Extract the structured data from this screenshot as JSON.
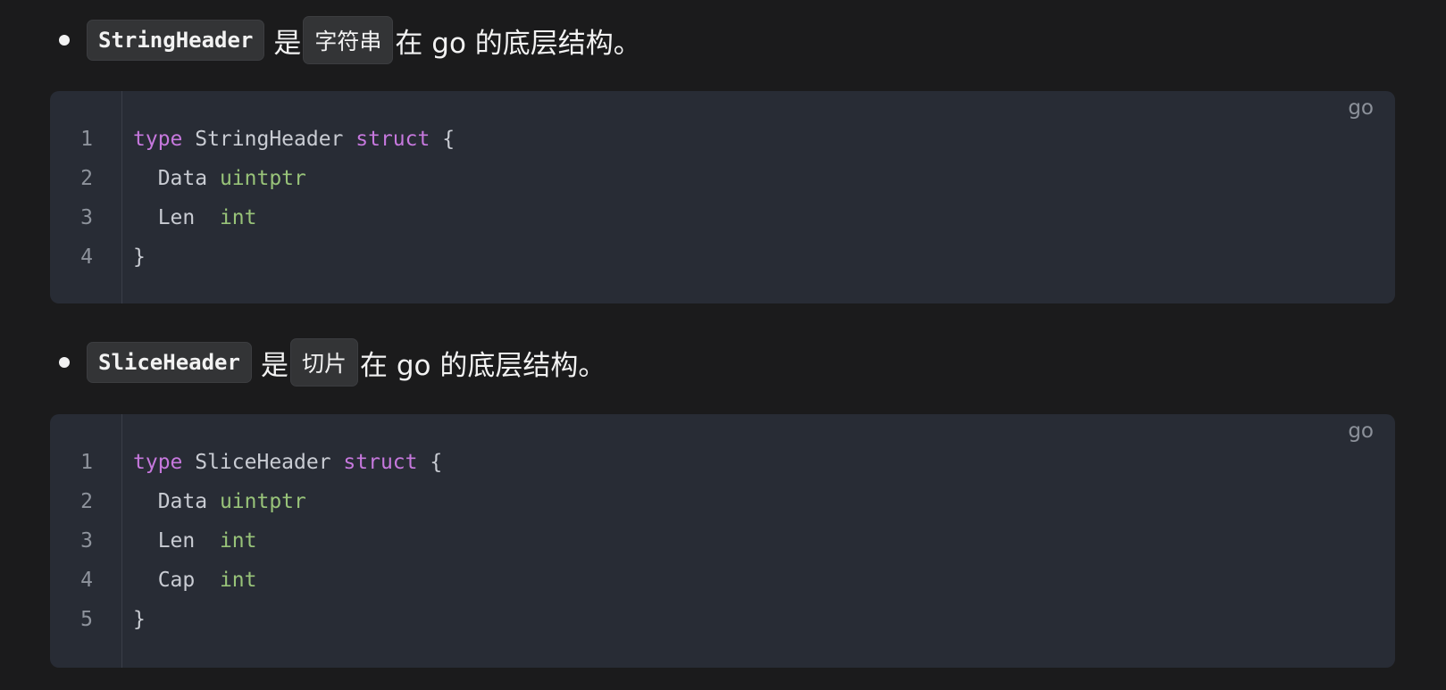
{
  "sections": [
    {
      "inline_code": "StringHeader",
      "connector": "是",
      "inline_term": "字符串",
      "suffix": "在 go 的底层结构。",
      "code_block": {
        "language": "go",
        "lines": [
          {
            "num": "1",
            "kw1": "type",
            "name": " StringHeader ",
            "kw2": "struct",
            "rest": " {"
          },
          {
            "num": "2",
            "field": "  Data ",
            "type": "uintptr"
          },
          {
            "num": "3",
            "field": "  Len  ",
            "type": "int"
          },
          {
            "num": "4",
            "close": "}"
          }
        ]
      }
    },
    {
      "inline_code": "SliceHeader",
      "connector": "是",
      "inline_term": "切片",
      "suffix": "在 go 的底层结构。",
      "code_block": {
        "language": "go",
        "lines": [
          {
            "num": "1",
            "kw1": "type",
            "name": " SliceHeader ",
            "kw2": "struct",
            "rest": " {"
          },
          {
            "num": "2",
            "field": "  Data ",
            "type": "uintptr"
          },
          {
            "num": "3",
            "field": "  Len  ",
            "type": "int"
          },
          {
            "num": "4",
            "field": "  Cap  ",
            "type": "int"
          },
          {
            "num": "5",
            "close": "}"
          }
        ]
      }
    }
  ],
  "colors": {
    "background": "#1b1b1c",
    "code_block_bg": "#282c35",
    "keyword": "#c678dd",
    "type": "#98c379",
    "identifier": "#c9ccd3",
    "line_number": "#8e939c"
  }
}
